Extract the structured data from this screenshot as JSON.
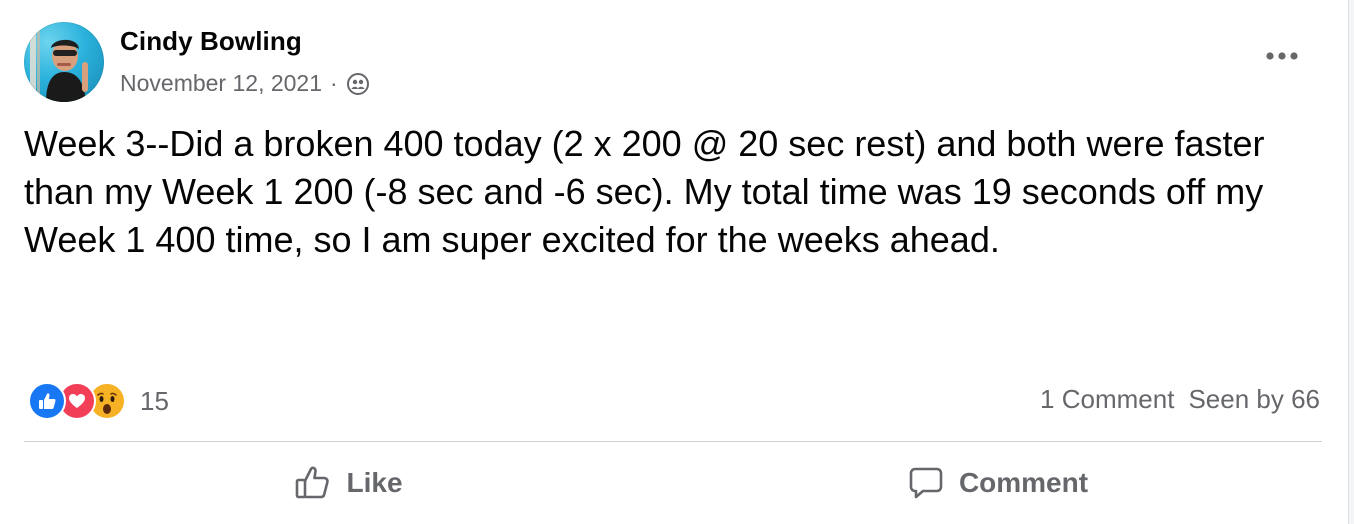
{
  "post": {
    "author": "Cindy Bowling",
    "date": "November 12, 2021",
    "separator": "·",
    "privacy_icon": "friends-icon",
    "more_icon": "more-horizontal-icon",
    "text": "Week 3--Did a broken 400 today (2 x 200 @ 20 sec rest) and both were faster than my Week 1 200 (-8 sec and -6 sec). My total time was 19 seconds off my Week 1 400 time, so I am super excited for the weeks ahead."
  },
  "stats": {
    "reactions": [
      "like",
      "love",
      "wow"
    ],
    "reaction_count": "15",
    "comments": "1 Comment",
    "seen_by": "Seen by 66"
  },
  "actions": {
    "like_label": "Like",
    "comment_label": "Comment"
  },
  "colors": {
    "like_blue": "#1877f2",
    "love_red": "#f33e58",
    "wow_yellow": "#f7b125",
    "secondary_text": "#65676b"
  }
}
